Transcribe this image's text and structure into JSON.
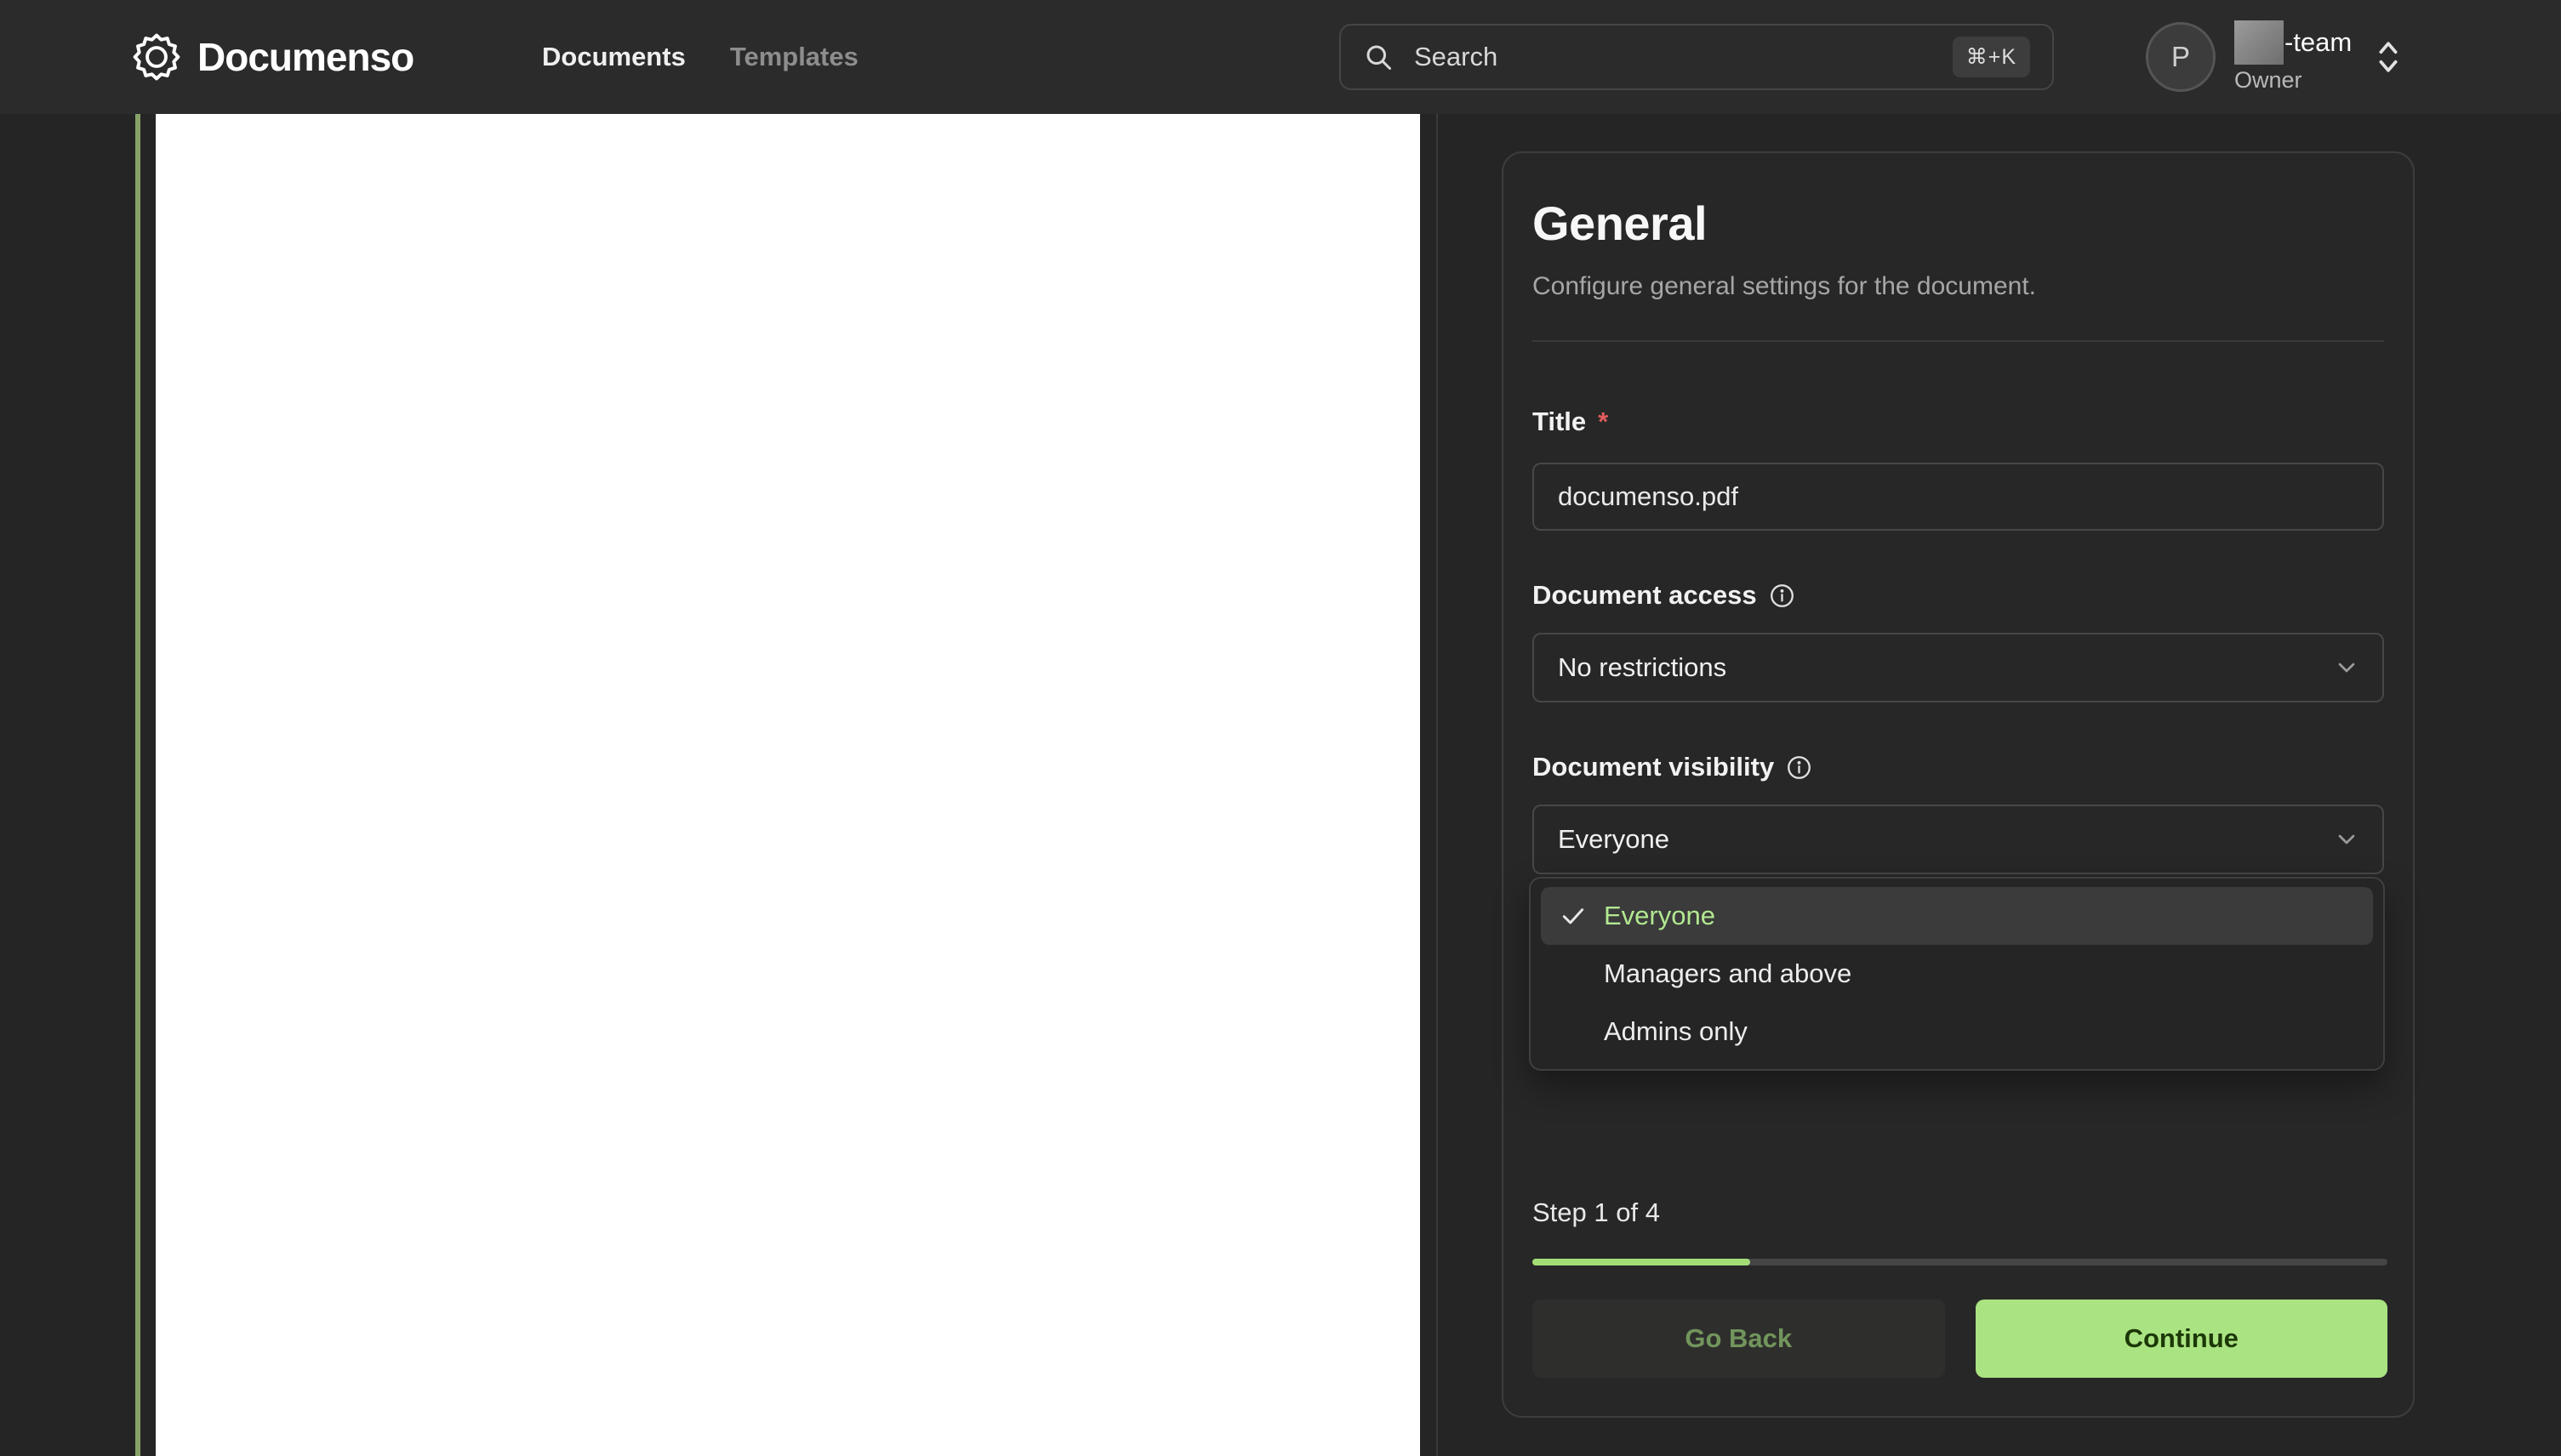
{
  "nav": {
    "brand": "Documenso",
    "links": [
      {
        "label": "Documents"
      },
      {
        "label": "Templates"
      }
    ],
    "search": {
      "placeholder": "Search",
      "shortcut": "⌘+K"
    },
    "account": {
      "initial": "P",
      "team_suffix": "-team",
      "role": "Owner"
    }
  },
  "panel": {
    "title": "General",
    "description": "Configure general settings for the document.",
    "fields": {
      "title": {
        "label": "Title",
        "required_mark": "*",
        "value": "documenso.pdf"
      },
      "access": {
        "label": "Document access",
        "value": "No restrictions"
      },
      "visibility": {
        "label": "Document visibility",
        "value": "Everyone"
      }
    },
    "dropdown": {
      "options": [
        {
          "label": "Everyone",
          "selected": true
        },
        {
          "label": "Managers and above",
          "selected": false
        },
        {
          "label": "Admins only",
          "selected": false
        }
      ]
    },
    "step": {
      "text": "Step 1 of 4",
      "progress_percent": 25.5
    },
    "buttons": {
      "back": "Go Back",
      "continue": "Continue"
    }
  },
  "colors": {
    "accent": "#a2e771",
    "progress_fill": "#a4dd76",
    "continue_bg": "#aae381",
    "continue_text": "#1c3807",
    "back_text": "#72955c",
    "highlight_green": "#b2e891",
    "asterisk": "#e25c5c"
  }
}
